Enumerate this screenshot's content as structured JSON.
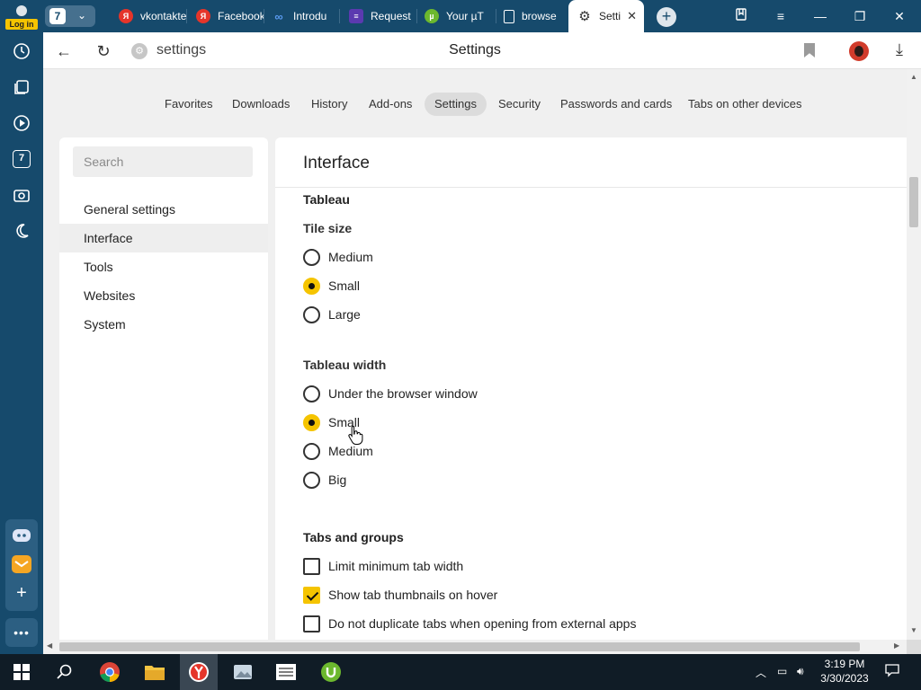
{
  "sidebar": {
    "login_label": "Log in",
    "counter": "7"
  },
  "tabs": {
    "counter": "7",
    "items": [
      {
        "label": "vkontakte",
        "icon": "yandex-icon",
        "color": "#e5352a"
      },
      {
        "label": "Facebook",
        "icon": "yandex-icon",
        "color": "#e5352a"
      },
      {
        "label": "Introdu",
        "icon": "meta-icon",
        "color": "#3a72d9"
      },
      {
        "label": "Request",
        "icon": "forms-icon",
        "color": "#5b3ab0"
      },
      {
        "label": "Your µT",
        "icon": "utorrent-icon",
        "color": "#6cb82e"
      },
      {
        "label": "browse",
        "icon": "document-icon",
        "color": "#ffffff"
      }
    ],
    "active": {
      "label": "Setti",
      "icon": "gear-icon"
    }
  },
  "addressbar": {
    "url": "settings",
    "page_title": "Settings"
  },
  "topnav": [
    {
      "label": "Favorites"
    },
    {
      "label": "Downloads"
    },
    {
      "label": "History"
    },
    {
      "label": "Add-ons"
    },
    {
      "label": "Settings",
      "active": true
    },
    {
      "label": "Security"
    },
    {
      "label": "Passwords and cards"
    },
    {
      "label": "Tabs on other devices"
    }
  ],
  "leftmenu": {
    "search_placeholder": "Search",
    "items": [
      {
        "label": "General settings"
      },
      {
        "label": "Interface",
        "active": true
      },
      {
        "label": "Tools"
      },
      {
        "label": "Websites"
      },
      {
        "label": "System"
      }
    ]
  },
  "main": {
    "title": "Interface",
    "section_tableau": "Tableau",
    "tile_size_label": "Tile size",
    "tile_size_options": [
      "Medium",
      "Small",
      "Large"
    ],
    "tile_size_selected": "Small",
    "tableau_width_label": "Tableau width",
    "tableau_width_options": [
      "Under the browser window",
      "Small",
      "Medium",
      "Big"
    ],
    "tableau_width_selected": "Small",
    "section_tabs": "Tabs and groups",
    "tabs_options": [
      {
        "label": "Limit minimum tab width",
        "checked": false
      },
      {
        "label": "Show tab thumbnails on hover",
        "checked": true
      },
      {
        "label": "Do not duplicate tabs when opening from external apps",
        "checked": false
      }
    ]
  },
  "taskbar": {
    "time": "3:19 PM",
    "date": "3/30/2023"
  },
  "colors": {
    "accent": "#f5c400",
    "chrome": "#164a6c"
  }
}
